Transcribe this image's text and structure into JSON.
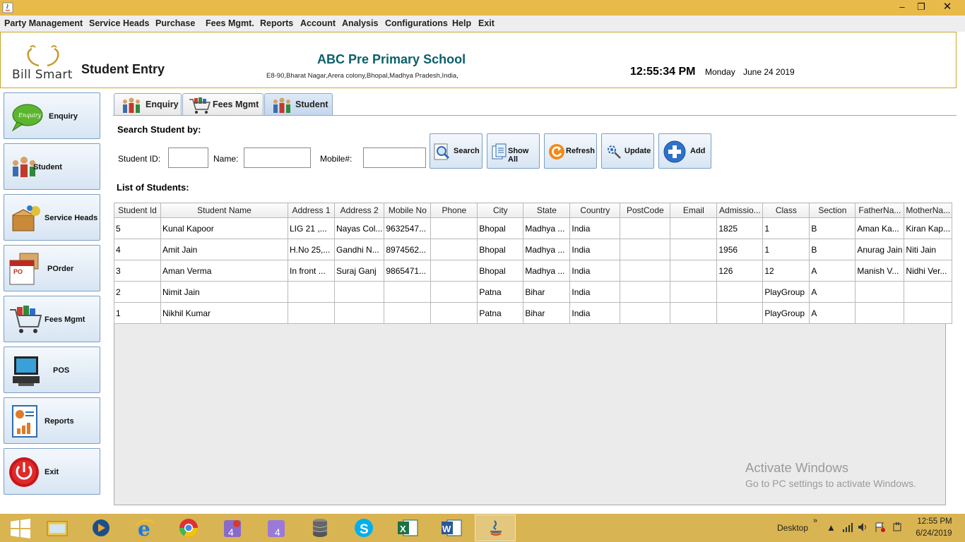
{
  "menu": [
    "Party Management",
    "Service Heads",
    "Purchase",
    "Fees Mgmt.",
    "Reports",
    "Account",
    "Analysis",
    "Configurations",
    "Help",
    "Exit"
  ],
  "window": {
    "minimize": "–",
    "restore": "❐",
    "close": "✕"
  },
  "header": {
    "logo_text": "Bill Smart",
    "page_title": "Student Entry",
    "school_name": "ABC Pre Primary School",
    "school_address": "E8-90,Bharat Nagar,Arera colony,Bhopal,Madhya Pradesh,India,",
    "time": "12:55:34 PM",
    "day": "Monday",
    "date": "June 24 2019"
  },
  "sidebar": [
    {
      "label": "Enquiry",
      "icon": "enquiry-bubble-icon"
    },
    {
      "label": "Student",
      "icon": "students-icon"
    },
    {
      "label": "Service Heads",
      "icon": "service-box-icon"
    },
    {
      "label": "POrder",
      "icon": "purchase-order-icon"
    },
    {
      "label": "Fees Mgmt",
      "icon": "shopping-cart-icon"
    },
    {
      "label": "POS",
      "icon": "pos-terminal-icon"
    },
    {
      "label": "Reports",
      "icon": "report-chart-icon"
    },
    {
      "label": "Exit",
      "icon": "power-icon"
    }
  ],
  "tabs": [
    {
      "label": "Enquiry",
      "icon": "students-icon"
    },
    {
      "label": "Fees Mgmt",
      "icon": "shopping-cart-icon"
    },
    {
      "label": "Student",
      "icon": "students-icon",
      "active": true
    }
  ],
  "search": {
    "title": "Search Student by:",
    "student_id_label": "Student ID:",
    "name_label": "Name:",
    "mobile_label": "Mobile#:",
    "student_id_value": "",
    "name_value": "",
    "mobile_value": ""
  },
  "actions": [
    {
      "label": "Search",
      "icon": "magnifier-icon"
    },
    {
      "label": "Show All",
      "icon": "documents-icon"
    },
    {
      "label": "Refresh",
      "icon": "refresh-icon"
    },
    {
      "label": "Update",
      "icon": "gear-icon"
    },
    {
      "label": "Add",
      "icon": "plus-icon"
    }
  ],
  "list_title": "List of Students:",
  "table": {
    "columns": [
      "Student Id",
      "Student Name",
      "Address 1",
      "Address 2",
      "Mobile No",
      "Phone",
      "City",
      "State",
      "Country",
      "PostCode",
      "Email",
      "Admissio...",
      "Class",
      "Section",
      "FatherNa...",
      "MotherNa..."
    ],
    "rows": [
      [
        "5",
        "Kunal Kapoor",
        "LIG 21 ,...",
        "Nayas Col...",
        "9632547...",
        "",
        "Bhopal",
        "Madhya ...",
        "India",
        "",
        "",
        "1825",
        "1",
        "B",
        "Aman Ka...",
        "Kiran Kap..."
      ],
      [
        "4",
        "Amit Jain",
        "H.No 25,...",
        "Gandhi N...",
        "8974562...",
        "",
        "Bhopal",
        "Madhya ...",
        "India",
        "",
        "",
        "1956",
        "1",
        "B",
        "Anurag Jain",
        "Niti Jain"
      ],
      [
        "3",
        "Aman Verma",
        "In front ...",
        "Suraj Ganj",
        "9865471...",
        "",
        "Bhopal",
        "Madhya ...",
        "India",
        "",
        "",
        "126",
        "12",
        "A",
        "Manish V...",
        "Nidhi Ver..."
      ],
      [
        "2",
        "Nimit Jain",
        "",
        "",
        "",
        "",
        "Patna",
        "Bihar",
        "India",
        "",
        "",
        "",
        "PlayGroup",
        "A",
        "",
        ""
      ],
      [
        "1",
        "Nikhil Kumar",
        "",
        "",
        "",
        "",
        "Patna",
        "Bihar",
        "India",
        "",
        "",
        "",
        "PlayGroup",
        "A",
        "",
        ""
      ]
    ]
  },
  "watermark": {
    "line1": "Activate Windows",
    "line2": "Go to PC settings to activate Windows."
  },
  "taskbar": {
    "apps": [
      "start-icon",
      "file-explorer-icon",
      "media-player-icon",
      "internet-explorer-icon",
      "chrome-icon",
      "app-4-icon",
      "app-4b-icon",
      "database-icon",
      "skype-icon",
      "excel-icon",
      "word-icon",
      "java-icon"
    ],
    "desktop_label": "Desktop",
    "chevron": "»",
    "time": "12:55 PM",
    "date": "6/24/2019"
  },
  "colors": {
    "titlebar": "#e8ba4a",
    "taskbar": "#d9b452",
    "school_name": "#0c5f6a",
    "button_gradient_top": "#f4f8fc",
    "button_gradient_bottom": "#d7e5f3"
  }
}
